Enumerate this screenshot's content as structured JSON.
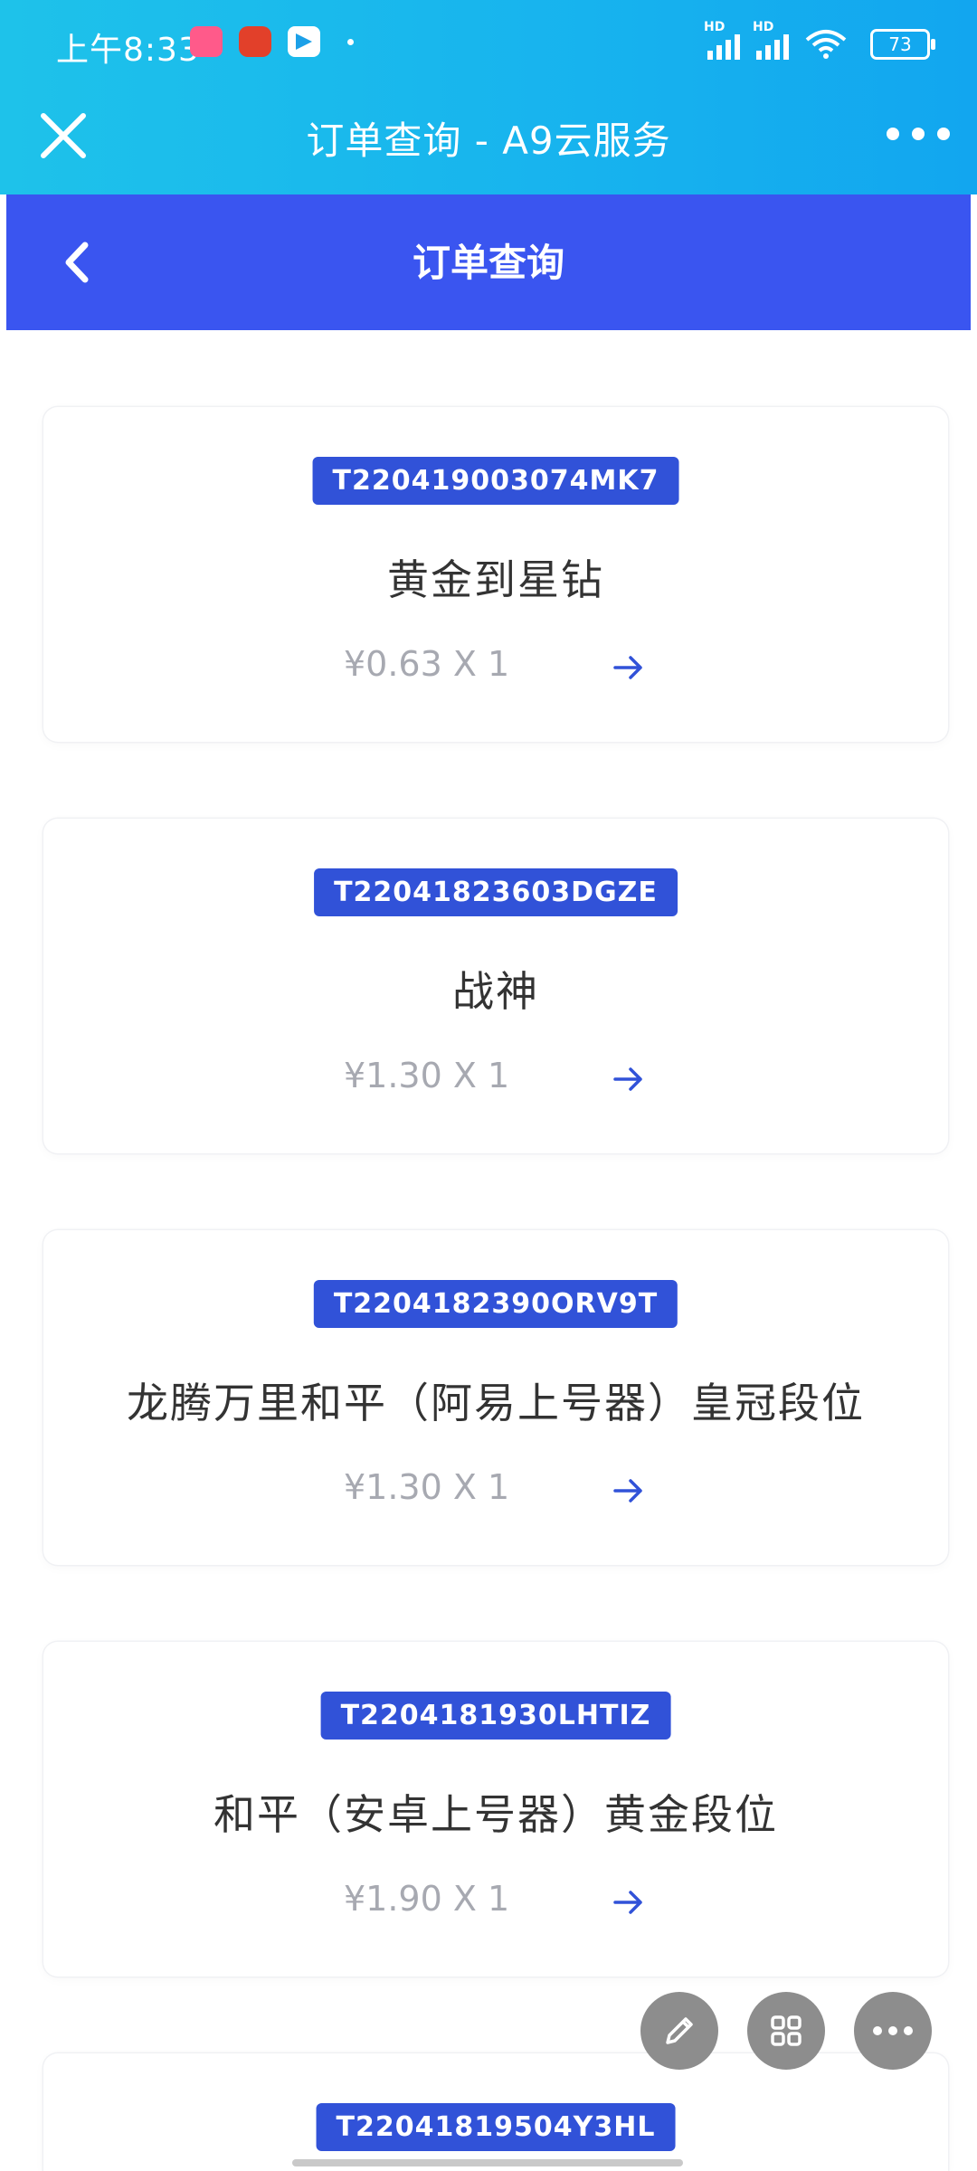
{
  "status_bar": {
    "time": "上午8:33",
    "battery": "73",
    "hd1": "HD",
    "hd2": "HD"
  },
  "app_bar": {
    "title": "订单查询 - A9云服务"
  },
  "page_header": {
    "title": "订单查询"
  },
  "orders": [
    {
      "order_no": "T220419003074MK7",
      "product": "黄金到星钻",
      "price": "¥0.63 X 1"
    },
    {
      "order_no": "T22041823603DGZE",
      "product": "战神",
      "price": "¥1.30 X 1"
    },
    {
      "order_no": "T2204182390ORV9T",
      "product": "龙腾万里和平（阿易上号器）皇冠段位",
      "price": "¥1.30 X 1"
    },
    {
      "order_no": "T2204181930LHTIZ",
      "product": "和平（安卓上号器）黄金段位",
      "price": "¥1.90 X 1"
    },
    {
      "order_no": "T22041819504Y3HL",
      "product": "",
      "price": ""
    }
  ],
  "colors": {
    "top_gradient_start": "#1ec2ea",
    "header_blue": "#3a55f0",
    "badge_blue": "#3152d8",
    "price_gray": "#a7a9b1",
    "arrow_blue": "#3152d8"
  },
  "fab_icons": [
    "pencil-icon",
    "grid-icon",
    "more-dots-icon"
  ]
}
